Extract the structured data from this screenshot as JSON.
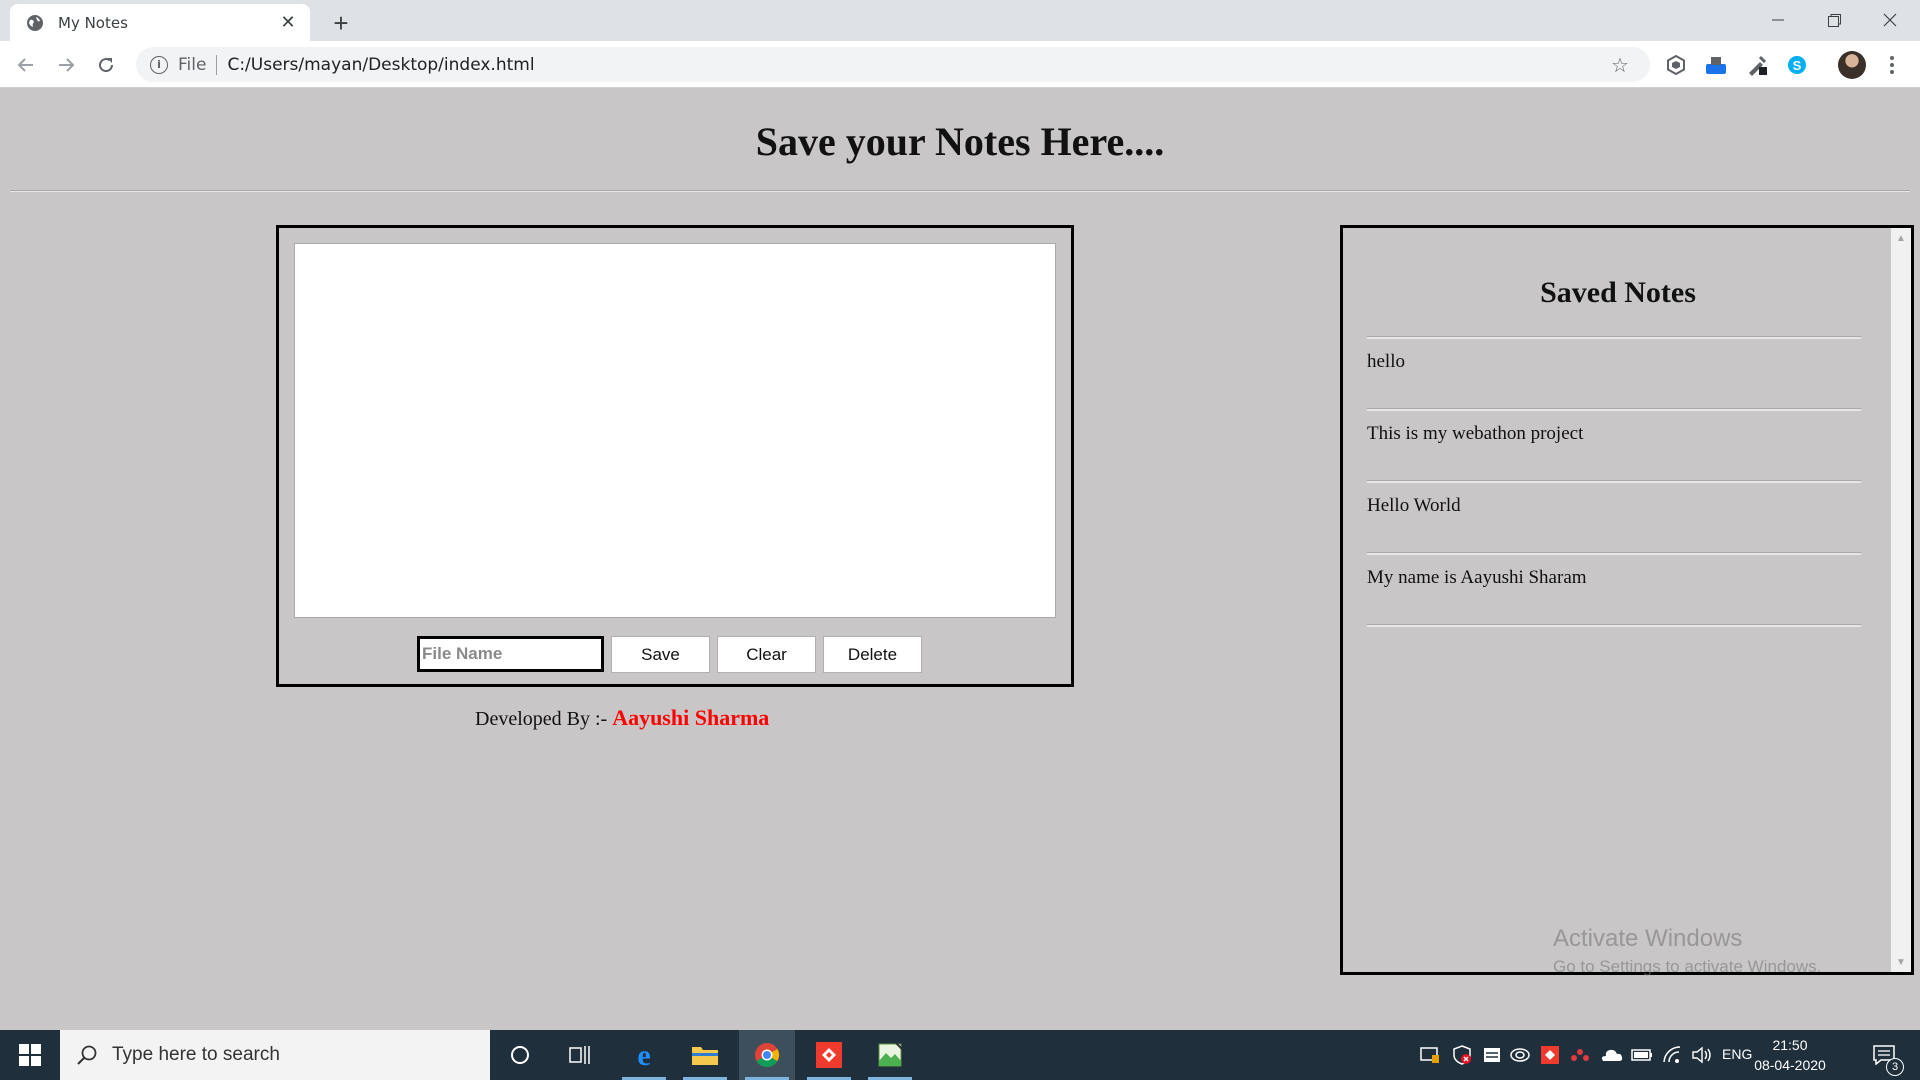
{
  "browser": {
    "tab_title": "My Notes",
    "omnibox_scheme_label": "File",
    "url": "C:/Users/mayan/Desktop/index.html"
  },
  "page": {
    "title": "Save your Notes Here....",
    "editor": {
      "textarea_value": "",
      "file_name_placeholder": "File Name",
      "save_label": "Save",
      "clear_label": "Clear",
      "delete_label": "Delete"
    },
    "credit": {
      "prefix": "Developed By :-",
      "name": "Aayushi Sharma"
    },
    "saved_notes": {
      "title": "Saved Notes",
      "items": [
        {
          "text": "hello"
        },
        {
          "text": "This is my webathon project"
        },
        {
          "text": "Hello World"
        },
        {
          "text": "My name is Aayushi Sharam"
        }
      ]
    },
    "watermark": {
      "line1": "Activate Windows",
      "line2": "Go to Settings to activate Windows."
    }
  },
  "taskbar": {
    "search_placeholder": "Type here to search",
    "language": "ENG",
    "time": "21:50",
    "date": "08-04-2020",
    "notification_count": "3"
  },
  "colors": {
    "page_bg": "#c8c6c7",
    "credit_name": "#ff0000",
    "taskbar_bg": "#1f2f3b"
  }
}
